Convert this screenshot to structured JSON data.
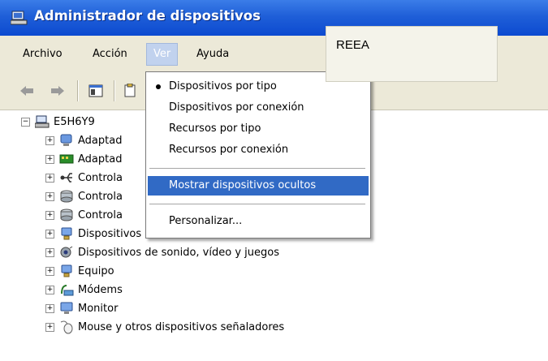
{
  "window": {
    "title": "Administrador de dispositivos"
  },
  "menubar": {
    "items": [
      "Archivo",
      "Acción",
      "Ver",
      "Ayuda"
    ]
  },
  "toolbar": {
    "buttons": [
      "back-icon",
      "forward-icon",
      "console-tree-icon",
      "properties-icon"
    ]
  },
  "tree": {
    "root": "E5H6Y9",
    "items": [
      "Adaptad",
      "Adaptad",
      "Controla",
      "Controla",
      "Controla",
      "Dispositivos de sistema",
      "Dispositivos de sonido, vídeo y juegos",
      "Equipo",
      "Módems",
      "Monitor",
      "Mouse y otros dispositivos señaladores"
    ]
  },
  "view_menu": {
    "items": [
      "Dispositivos por tipo",
      "Dispositivos por conexión",
      "Recursos por tipo",
      "Recursos por conexión",
      "Mostrar dispositivos ocultos",
      "Personalizar..."
    ],
    "selected_index": 0,
    "highlighted_index": 4
  },
  "tooltip": {
    "text": "REEA"
  },
  "colors": {
    "titlebar": "#0c4ad0",
    "highlight": "#316ac5",
    "menubar": "#ece9d8"
  }
}
